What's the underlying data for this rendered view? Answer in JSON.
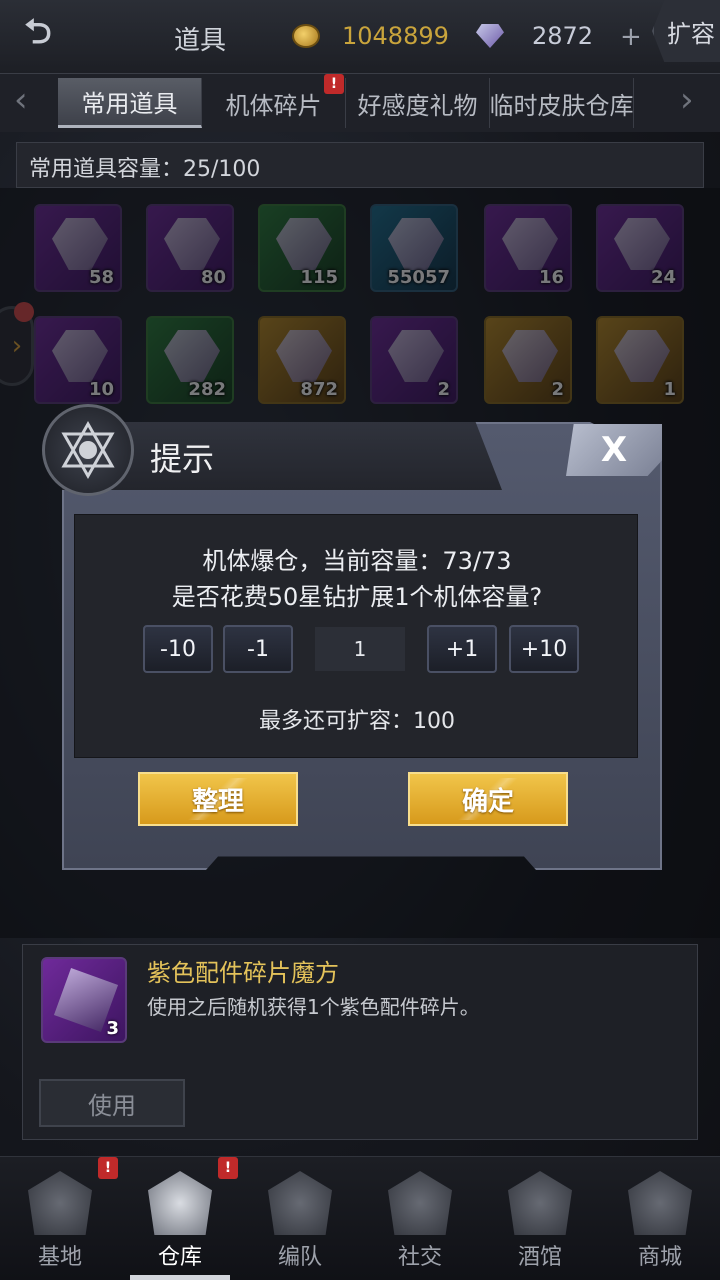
{
  "header": {
    "title": "道具",
    "coins": "1048899",
    "gems": "2872",
    "add_label": "+",
    "expand_label": "扩容"
  },
  "tabs": [
    {
      "label": "常用道具",
      "active": true
    },
    {
      "label": "机体碎片",
      "alert": "!"
    },
    {
      "label": "好感度礼物"
    },
    {
      "label": "临时皮肤仓库"
    }
  ],
  "capacity": {
    "text": "常用道具容量：25/100"
  },
  "items": [
    {
      "count": "58"
    },
    {
      "count": "80"
    },
    {
      "count": "115"
    },
    {
      "count": "55057"
    },
    {
      "count": "16"
    },
    {
      "count": "24"
    },
    {
      "count": "10"
    },
    {
      "count": "282"
    },
    {
      "count": "872"
    },
    {
      "count": "2"
    },
    {
      "count": "2"
    },
    {
      "count": "1"
    }
  ],
  "dialog": {
    "title": "提示",
    "close_label": "X",
    "line1": "机体爆仓，当前容量：73/73",
    "line2": "是否花费50星钻扩展1个机体容量?",
    "steppers": {
      "minus10": "-10",
      "minus1": "-1",
      "plus1": "+1",
      "plus10": "+10"
    },
    "quantity": "1",
    "max_text": "最多还可扩容：100",
    "sort_label": "整理",
    "confirm_label": "确定"
  },
  "detail": {
    "name": "紫色配件碎片魔方",
    "description": "使用之后随机获得1个紫色配件碎片。",
    "count": "3",
    "use_label": "使用"
  },
  "nav": [
    {
      "label": "基地",
      "alert": "!"
    },
    {
      "label": "仓库",
      "alert": "!",
      "active": true
    },
    {
      "label": "编队"
    },
    {
      "label": "社交"
    },
    {
      "label": "酒馆"
    },
    {
      "label": "商城"
    }
  ]
}
